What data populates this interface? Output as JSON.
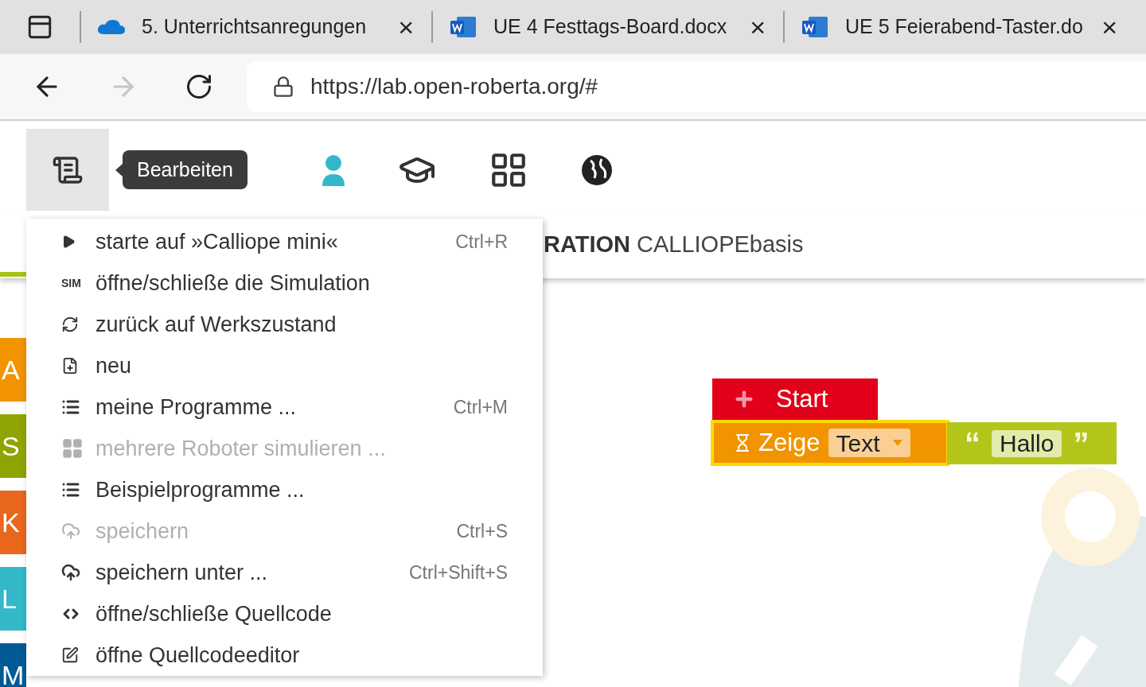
{
  "browser_tabs": [
    {
      "title": "5. Unterrichtsanregungen",
      "close": "×"
    },
    {
      "title": "UE 4 Festtags-Board.docx",
      "close": "×"
    },
    {
      "title": "UE 5 Feierabend-Taster.do",
      "close": "×"
    }
  ],
  "address_bar": {
    "url": "https://lab.open-roberta.org/#"
  },
  "toolbar": {
    "menu_selected": true,
    "tooltip": "Bearbeiten"
  },
  "header": {
    "label": "RATION",
    "name": "CALLIOPEbasis"
  },
  "categories": [
    {
      "letter": "A",
      "color": "#f29400"
    },
    {
      "letter": "S",
      "color": "#8fa402"
    },
    {
      "letter": "K",
      "color": "#e8671d"
    },
    {
      "letter": "L",
      "color": "#33b8ca"
    },
    {
      "letter": "M",
      "color": "#005a94"
    }
  ],
  "menu": [
    {
      "label": "starte auf »Calliope mini«",
      "shortcut": "Ctrl+R",
      "disabled": false
    },
    {
      "label": "öffne/schließe die Simulation",
      "icon_text": "SIM",
      "disabled": false
    },
    {
      "label": "zurück auf Werkszustand",
      "disabled": false
    },
    {
      "label": "neu",
      "disabled": false
    },
    {
      "label": "meine Programme ...",
      "shortcut": "Ctrl+M",
      "disabled": false
    },
    {
      "label": "mehrere Roboter simulieren ...",
      "disabled": true
    },
    {
      "label": "Beispielprogramme ...",
      "disabled": false
    },
    {
      "label": "speichern",
      "shortcut": "Ctrl+S",
      "disabled": true
    },
    {
      "label": "speichern unter ...",
      "shortcut": "Ctrl+Shift+S",
      "disabled": false
    },
    {
      "label": "öffne/schließe Quellcode",
      "disabled": false
    },
    {
      "label": "öffne Quellcodeeditor",
      "disabled": false
    }
  ],
  "blocks": {
    "start": "Start",
    "show": "Zeige",
    "show_selected": true,
    "dropdown": "Text",
    "open_quote": "“",
    "text_value": "Hallo",
    "close_quote": "”"
  }
}
